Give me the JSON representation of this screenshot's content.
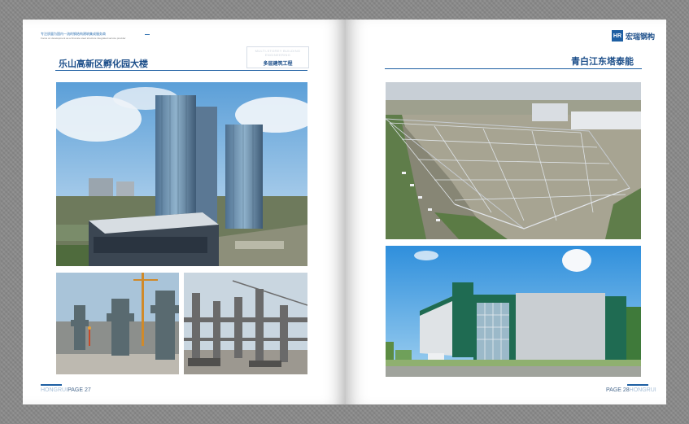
{
  "left_page": {
    "tagline": "专注质量为国内一流的钢结构建筑集成服务商",
    "tagline_sub": "Focus on development as a first-rate steel structure integrated service provider",
    "title": "乐山高新区孵化园大楼",
    "stamp_faint": "MULTI-STOREY BUILDING ENGINEERING",
    "stamp_label": "多层建筑工程",
    "page_label": "PAGE 27",
    "page_label_faint": "HONGRUI"
  },
  "right_page": {
    "logo_mark": "HR",
    "logo_text": "宏瑞钢构",
    "title": "青白江东塔泰能",
    "page_label": "PAGE 28",
    "page_label_faint": "HONGRUI"
  },
  "colors": {
    "brand_blue": "#1e5fa3",
    "title_blue": "#1d4f8a",
    "background_gray": "#8a8a8a"
  }
}
